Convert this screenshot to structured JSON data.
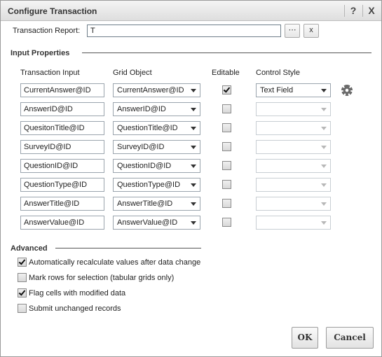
{
  "window": {
    "title": "Configure Transaction",
    "help_label": "?",
    "close_label": "X"
  },
  "report": {
    "label": "Transaction Report:",
    "value": "T",
    "browse_label": "⋯",
    "clear_label": "x"
  },
  "input_properties": {
    "title": "Input Properties",
    "headers": {
      "input": "Transaction Input",
      "grid": "Grid Object",
      "editable": "Editable",
      "style": "Control Style"
    },
    "rows": [
      {
        "input": "CurrentAnswer@ID",
        "grid": "CurrentAnswer@ID",
        "editable": true,
        "style": "Text Field"
      },
      {
        "input": "AnswerID@ID",
        "grid": "AnswerID@ID",
        "editable": false,
        "style": ""
      },
      {
        "input": "QuesitonTitle@ID",
        "grid": "QuestionTitle@ID",
        "editable": false,
        "style": ""
      },
      {
        "input": "SurveyID@ID",
        "grid": "SurveyID@ID",
        "editable": false,
        "style": ""
      },
      {
        "input": "QuestionID@ID",
        "grid": "QuestionID@ID",
        "editable": false,
        "style": ""
      },
      {
        "input": "QuestionType@ID",
        "grid": "QuestionType@ID",
        "editable": false,
        "style": ""
      },
      {
        "input": "AnswerTitle@ID",
        "grid": "AnswerTitle@ID",
        "editable": false,
        "style": ""
      },
      {
        "input": "AnswerValue@ID",
        "grid": "AnswerValue@ID",
        "editable": false,
        "style": ""
      }
    ]
  },
  "advanced": {
    "title": "Advanced",
    "options": [
      {
        "label": "Automatically recalculate values after data change",
        "checked": true
      },
      {
        "label": "Mark rows for selection (tabular grids only)",
        "checked": false
      },
      {
        "label": "Flag cells with modified data",
        "checked": true
      },
      {
        "label": "Submit unchanged records",
        "checked": false
      }
    ]
  },
  "footer": {
    "ok_label": "OK",
    "cancel_label": "Cancel"
  }
}
